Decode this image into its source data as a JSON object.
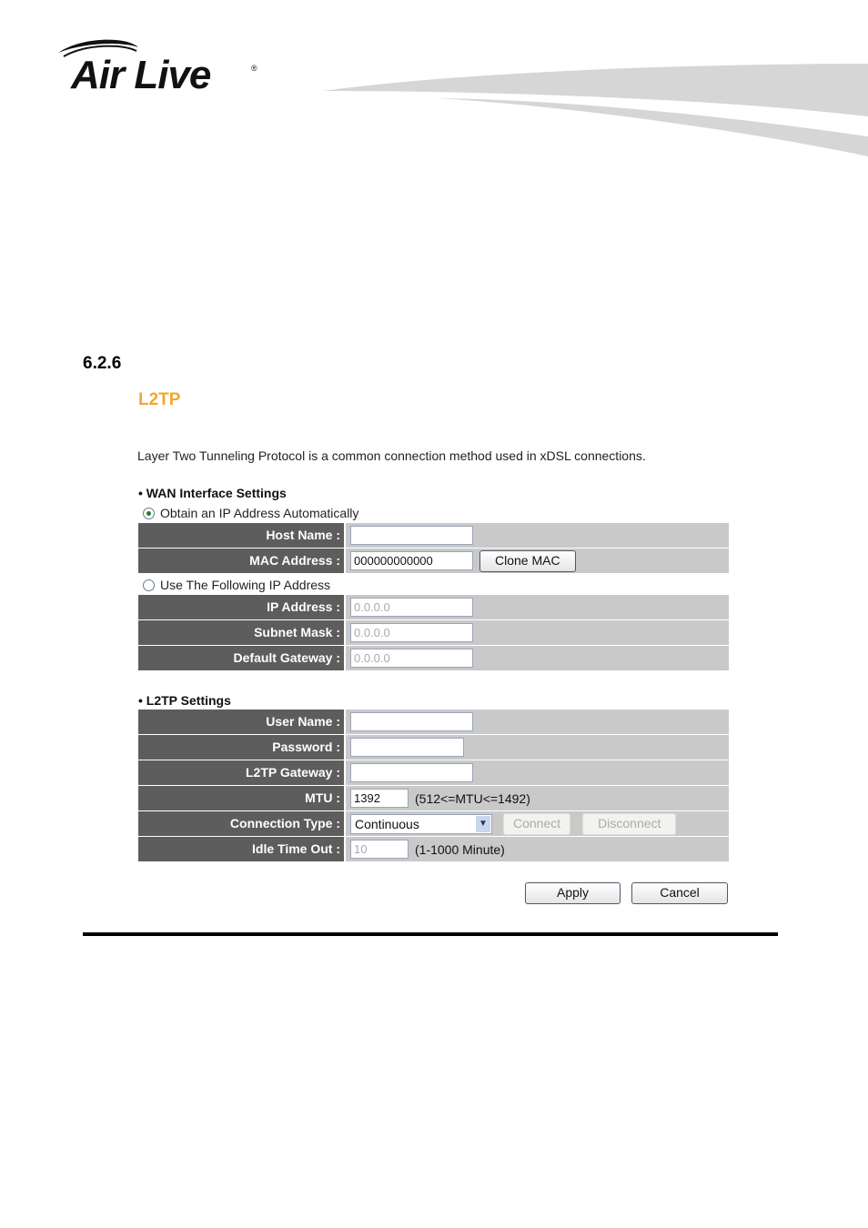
{
  "logo": {
    "text": "Air Live",
    "registered": "®"
  },
  "section_number": "6.2.6",
  "page_title": "L2TP",
  "description": "Layer Two Tunneling Protocol is a common connection method used in xDSL connections.",
  "wan": {
    "heading": "WAN Interface Settings",
    "obtain_auto": {
      "label": "Obtain an IP Address Automatically",
      "selected": true
    },
    "host_name": {
      "label": "Host Name :",
      "value": ""
    },
    "mac_address": {
      "label": "MAC Address :",
      "value": "000000000000",
      "clone_label": "Clone MAC"
    },
    "use_following": {
      "label": "Use The Following IP Address",
      "selected": false
    },
    "ip_address": {
      "label": "IP Address :",
      "value": "0.0.0.0"
    },
    "subnet_mask": {
      "label": "Subnet Mask :",
      "value": "0.0.0.0"
    },
    "default_gateway": {
      "label": "Default Gateway :",
      "value": "0.0.0.0"
    }
  },
  "l2tp": {
    "heading": "L2TP Settings",
    "user_name": {
      "label": "User Name :",
      "value": ""
    },
    "password": {
      "label": "Password :",
      "value": ""
    },
    "gateway": {
      "label": "L2TP Gateway :",
      "value": ""
    },
    "mtu": {
      "label": "MTU :",
      "value": "1392",
      "hint": "(512<=MTU<=1492)"
    },
    "connection_type": {
      "label": "Connection Type :",
      "value": "Continuous",
      "connect_label": "Connect",
      "disconnect_label": "Disconnect"
    },
    "idle_time": {
      "label": "Idle Time Out :",
      "value": "10",
      "hint": "(1-1000 Minute)"
    }
  },
  "actions": {
    "apply": "Apply",
    "cancel": "Cancel"
  },
  "colors": {
    "title": "#f0a830",
    "label_bg": "#5d5d5d",
    "value_bg": "#c9c9c9"
  }
}
